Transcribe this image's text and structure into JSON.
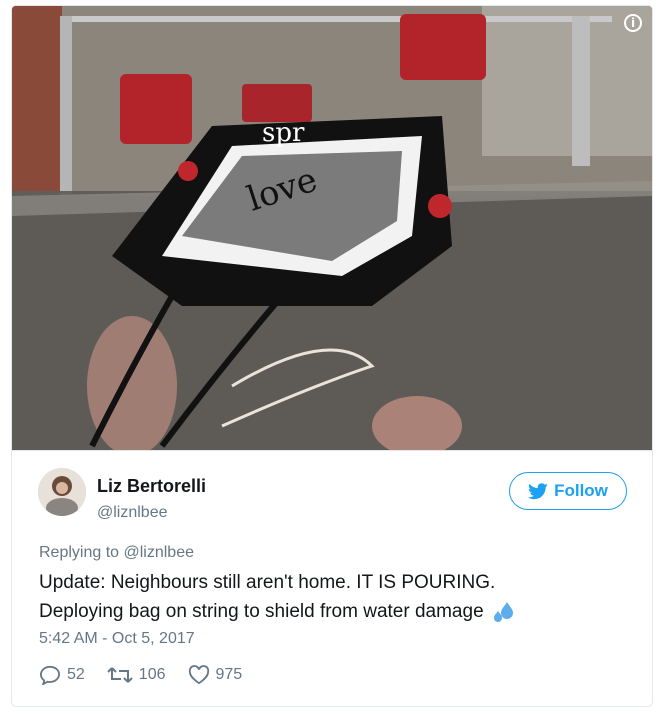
{
  "user": {
    "name": "Liz Bertorelli",
    "handle": "@liznlbee"
  },
  "follow_button": {
    "label": "Follow"
  },
  "reply_context": {
    "prefix": "Replying to",
    "mention": "@liznlbee"
  },
  "tweet": {
    "line1": "Update: Neighbours still aren't home. IT IS POURING.",
    "line2": "Deploying bag on string to shield from water damage",
    "emoji_icon": "sweat-droplets-icon",
    "timestamp": "5:42 AM - Oct 5, 2017"
  },
  "stats": {
    "replies": "52",
    "retweets": "106",
    "likes": "975"
  },
  "media": {
    "info_glyph": "i"
  },
  "colors": {
    "accent": "#1da1f2",
    "muted": "#657786",
    "text": "#14171a",
    "border": "#e1e8ed"
  }
}
